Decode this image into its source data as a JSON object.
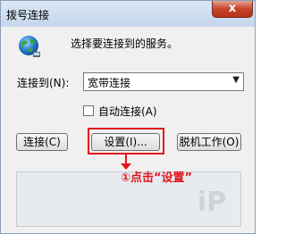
{
  "window": {
    "title": "拨号连接",
    "close_glyph": "x"
  },
  "header": {
    "icon": "globe-network-icon",
    "text": "选择要连接到的服务。"
  },
  "connect_to": {
    "label": "连接到(N):",
    "selected": "宽带连接",
    "dropdown_arrow": "▼"
  },
  "auto_connect": {
    "label": "自动连接(A)",
    "checked": false
  },
  "buttons": {
    "connect": "连接(C)",
    "settings": "设置(I)...",
    "offline": "脱机工作(O)"
  },
  "annotation": {
    "text": "①点击“设置”",
    "color": "#e1151b"
  },
  "watermark": {
    "text": "iP"
  }
}
